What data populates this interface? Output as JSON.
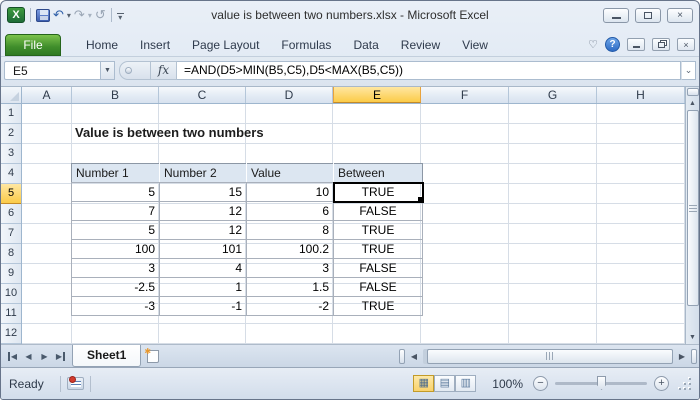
{
  "titlebar": {
    "title": "value is between two numbers.xlsx  -  Microsoft Excel",
    "icons": {
      "undo": "↶",
      "redo": "↷",
      "repeat": "↺",
      "dropdown": "▾",
      "excel_logo": "X",
      "close": "×"
    }
  },
  "ribbon": {
    "file_tab": "File",
    "tabs": [
      "Home",
      "Insert",
      "Page Layout",
      "Formulas",
      "Data",
      "Review",
      "View"
    ],
    "icons": {
      "minimize_ribbon": "♡",
      "help": "?",
      "close": "×"
    }
  },
  "formula_bar": {
    "name_box": "E5",
    "name_dropdown": "▼",
    "fx_label": "fx",
    "formula": "=AND(D5>MIN(B5,C5),D5<MAX(B5,C5))",
    "expand": "⌄"
  },
  "grid": {
    "columns": [
      "A",
      "B",
      "C",
      "D",
      "E",
      "F",
      "G",
      "H"
    ],
    "rows": [
      "1",
      "2",
      "3",
      "4",
      "5",
      "6",
      "7",
      "8",
      "9",
      "10",
      "11",
      "12"
    ],
    "selected_cell": "E5",
    "selected_column": "E",
    "selected_row": "5",
    "title_text": "Value is between two numbers",
    "table": {
      "headers": [
        "Number 1",
        "Number 2",
        "Value",
        "Between"
      ],
      "rows": [
        [
          "5",
          "15",
          "10",
          "TRUE"
        ],
        [
          "7",
          "12",
          "6",
          "FALSE"
        ],
        [
          "5",
          "12",
          "8",
          "TRUE"
        ],
        [
          "100",
          "101",
          "100.2",
          "TRUE"
        ],
        [
          "3",
          "4",
          "3",
          "FALSE"
        ],
        [
          "-2.5",
          "1",
          "1.5",
          "FALSE"
        ],
        [
          "-3",
          "-1",
          "-2",
          "TRUE"
        ]
      ]
    }
  },
  "sheet_bar": {
    "tab": "Sheet1",
    "icons": {
      "first": "◀",
      "prev": "◀",
      "next": "▶",
      "last": "▶",
      "insert_star": "✱",
      "left": "◀",
      "right": "▶"
    }
  },
  "scrollbar": {
    "icons": {
      "up": "▲",
      "down": "▼"
    }
  },
  "status_bar": {
    "ready": "Ready",
    "zoom_level": "100%",
    "icons": {
      "view_normal": "▦",
      "view_layout": "▤",
      "view_break": "▥",
      "zoom_out": "−",
      "zoom_in": "+"
    }
  },
  "colors": {
    "selected_header_fill": "#FBCB48",
    "table_header_fill": "#DCE6F1",
    "file_tab_green": "#3F8D2B",
    "gridline": "#D6DDE6",
    "selection_border": "#000000"
  }
}
